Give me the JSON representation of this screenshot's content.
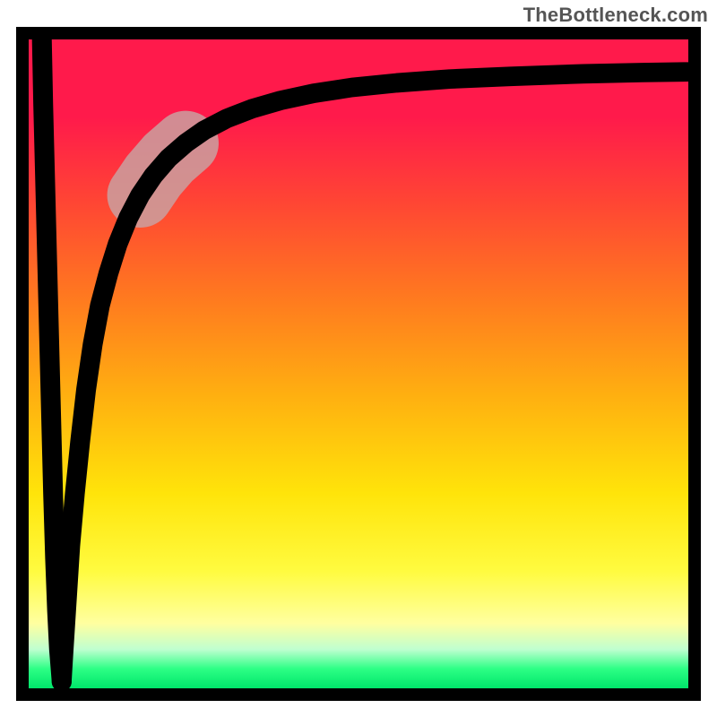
{
  "attribution": "TheBottleneck.com",
  "colors": {
    "frame": "#000000",
    "curve": "#000000",
    "highlight": "#caa0a0",
    "gradient_stops": [
      "#ff1a4b",
      "#ff4534",
      "#ff7a1f",
      "#ffb010",
      "#ffe40a",
      "#fffb40",
      "#ffffa0",
      "#bfffd0",
      "#2cff85",
      "#00e56a"
    ]
  },
  "chart_data": {
    "type": "line",
    "title": "",
    "xlabel": "",
    "ylabel": "",
    "xlim": [
      0,
      100
    ],
    "ylim": [
      0,
      100
    ],
    "background": "vertical rainbow gradient (red at top to green at bottom)",
    "series": [
      {
        "name": "left-descent",
        "x": [
          2.0,
          2.2,
          2.5,
          2.8,
          3.1,
          3.4,
          3.7,
          4.0,
          4.3,
          4.6,
          5.0
        ],
        "y": [
          100,
          90,
          78,
          66,
          54,
          42,
          30,
          20,
          12,
          6,
          1
        ]
      },
      {
        "name": "right-ascent",
        "x": [
          5.0,
          5.3,
          5.8,
          6.3,
          7.0,
          7.8,
          8.7,
          9.7,
          10.8,
          12.1,
          13.5,
          15.1,
          16.9,
          18.9,
          21.2,
          23.8,
          26.6,
          30.0,
          33.8,
          38.2,
          43.2,
          49.0,
          55.8,
          63.8,
          73.0,
          84.0,
          93.0,
          100.0
        ],
        "y": [
          1,
          6,
          14,
          22,
          30,
          38,
          46,
          53,
          59,
          64,
          68.5,
          72.5,
          76,
          79,
          81.7,
          84,
          86,
          87.8,
          89.3,
          90.6,
          91.7,
          92.6,
          93.3,
          93.9,
          94.3,
          94.7,
          94.9,
          95.0
        ]
      }
    ],
    "annotations": [
      {
        "name": "highlight-band",
        "description": "pale segment overlaying the curve",
        "x_range": [
          16.5,
          24.0
        ],
        "y_range": [
          75,
          84
        ]
      }
    ]
  }
}
